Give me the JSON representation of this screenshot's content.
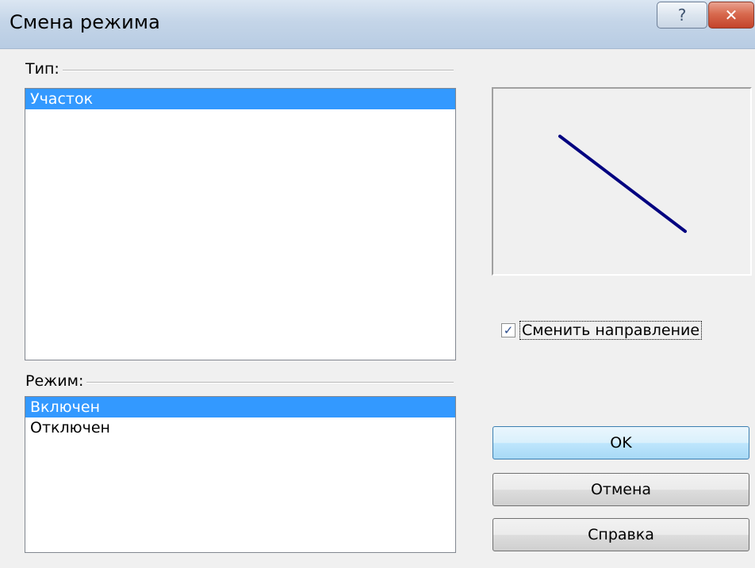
{
  "window": {
    "title": "Смена режима",
    "help_glyph": "?",
    "close_glyph": "✕"
  },
  "type_group": {
    "label": "Тип:",
    "items": [
      {
        "label": "Участок",
        "selected": true
      }
    ]
  },
  "mode_group": {
    "label": "Режим:",
    "items": [
      {
        "label": "Включен",
        "selected": true
      },
      {
        "label": "Отключен",
        "selected": false
      }
    ]
  },
  "preview": {
    "line_color": "#000080"
  },
  "direction_checkbox": {
    "label": "Сменить направление",
    "checked": true,
    "check_glyph": "✓"
  },
  "buttons": {
    "ok": "OK",
    "cancel": "Отмена",
    "help": "Справка"
  },
  "colors": {
    "selection": "#3399ff",
    "dialog_bg": "#f0f0f0"
  }
}
